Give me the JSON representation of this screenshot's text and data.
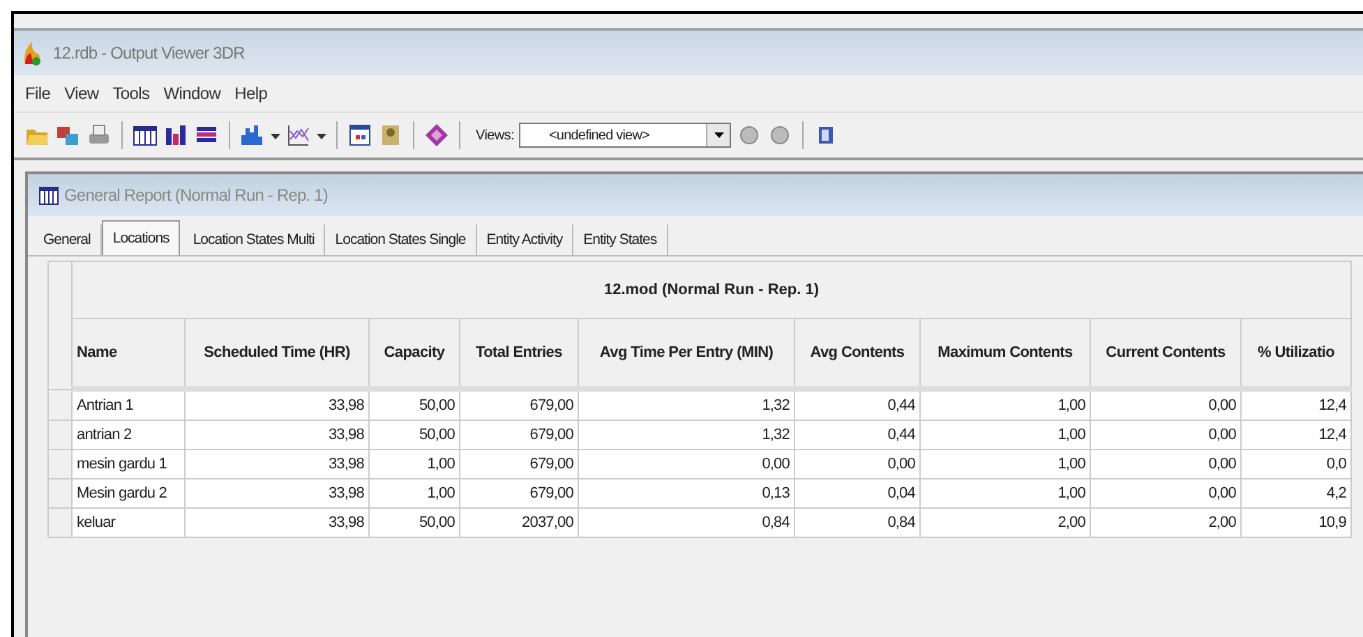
{
  "window": {
    "title": "12.rdb - Output Viewer 3DR"
  },
  "menu": [
    "File",
    "View",
    "Tools",
    "Window",
    "Help"
  ],
  "toolbar": {
    "views_label": "Views:",
    "views_value": "<undefined view>"
  },
  "report": {
    "title": "General Report (Normal Run - Rep. 1)",
    "tabs": [
      {
        "label": "General",
        "selected": false
      },
      {
        "label": "Locations",
        "selected": true
      },
      {
        "label": "Location States Multi",
        "selected": false
      },
      {
        "label": "Location States Single",
        "selected": false
      },
      {
        "label": "Entity Activity",
        "selected": false
      },
      {
        "label": "Entity States",
        "selected": false
      }
    ],
    "table": {
      "caption": "12.mod (Normal Run - Rep. 1)",
      "columns": [
        "Name",
        "Scheduled Time (HR)",
        "Capacity",
        "Total Entries",
        "Avg Time Per Entry (MIN)",
        "Avg Contents",
        "Maximum Contents",
        "Current Contents",
        "% Utilizatio"
      ],
      "rows": [
        [
          "Antrian 1",
          "33,98",
          "50,00",
          "679,00",
          "1,32",
          "0,44",
          "1,00",
          "0,00",
          "12,4"
        ],
        [
          "antrian 2",
          "33,98",
          "50,00",
          "679,00",
          "1,32",
          "0,44",
          "1,00",
          "0,00",
          "12,4"
        ],
        [
          "mesin gardu 1",
          "33,98",
          "1,00",
          "679,00",
          "0,00",
          "0,00",
          "1,00",
          "0,00",
          "0,0"
        ],
        [
          "Mesin gardu 2",
          "33,98",
          "1,00",
          "679,00",
          "0,13",
          "0,04",
          "1,00",
          "0,00",
          "4,2"
        ],
        [
          "keluar",
          "33,98",
          "50,00",
          "2037,00",
          "0,84",
          "0,84",
          "2,00",
          "2,00",
          "10,9"
        ]
      ]
    }
  }
}
